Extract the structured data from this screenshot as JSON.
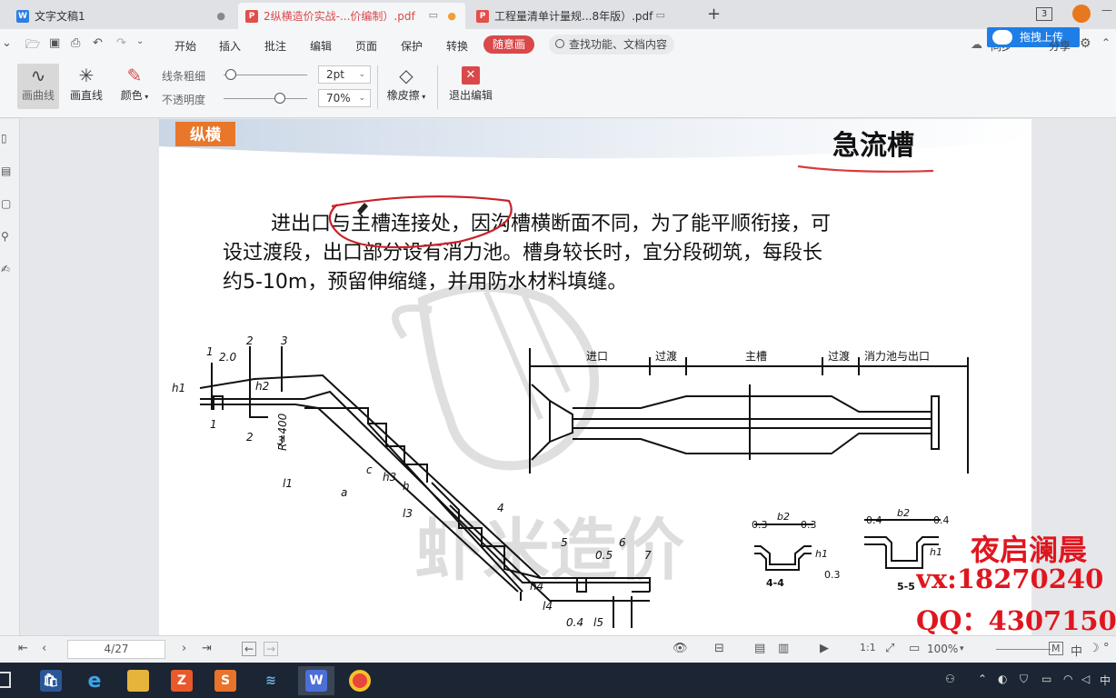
{
  "tabs": [
    {
      "label": "文字文稿1",
      "icon": "W",
      "icon_color": "#2f7de1"
    },
    {
      "label": "2纵横造价实战-...价编制）.pdf",
      "icon": "P",
      "icon_color": "#e2504a"
    },
    {
      "label": "工程量清单计量规...8年版）.pdf",
      "icon": "P",
      "icon_color": "#e2504a"
    }
  ],
  "new_tab_glyph": "+",
  "window_badge": "3",
  "menu": [
    "开始",
    "插入",
    "批注",
    "编辑",
    "页面",
    "保护",
    "转换"
  ],
  "menu_active": "随意画",
  "search_placeholder": "查找功能、文档内容",
  "upload_label": "拖拽上传",
  "sync_label": "同步",
  "share_label": "分享",
  "toolbar": {
    "curve": "画曲线",
    "line": "画直线",
    "color": "颜色",
    "thickness_label": "线条粗细",
    "opacity_label": "不透明度",
    "thickness_value": "2pt",
    "opacity_value": "70%",
    "thickness_level": 0.1,
    "opacity_level": 0.7,
    "eraser": "橡皮擦",
    "exit": "退出编辑"
  },
  "document": {
    "badge": "纵横",
    "title": "急流槽",
    "paragraph_lines": [
      "进出口与主槽连接处，因沟槽横断面不同，为了能平顺衔接，可",
      "设过渡段，出口部分设有消力池。槽身较长时，宜分段砌筑，每段长",
      "约5-10m，预留伸缩缝，并用防水材料填缝。"
    ],
    "watermark": "虾米造价",
    "plan_labels": [
      "进口",
      "过渡",
      "主槽",
      "过渡",
      "消力池与出口"
    ],
    "section_labels": [
      "1",
      "2",
      "3",
      "2.0",
      "h1",
      "h2",
      "R=400",
      "l1",
      "a",
      "c",
      "h3",
      "h",
      "l3",
      "4",
      "5",
      "6",
      "7",
      "0.5",
      "h4",
      "l4",
      "0.4",
      "l5",
      "1",
      "2",
      "3"
    ],
    "sec44": {
      "title": "4-4",
      "dims": [
        "0.3",
        "b2",
        "0.3",
        "h1",
        "0.3"
      ]
    },
    "sec55": {
      "title": "5-5",
      "dims": [
        "0.4",
        "b2",
        "0.4",
        "h1"
      ]
    }
  },
  "contact": {
    "name": "夜启澜晨",
    "vx": "vx:18270240",
    "qq": "QQ：4307150"
  },
  "status": {
    "page_indicator": "4/27",
    "zoom": "100%",
    "ime": "中"
  }
}
